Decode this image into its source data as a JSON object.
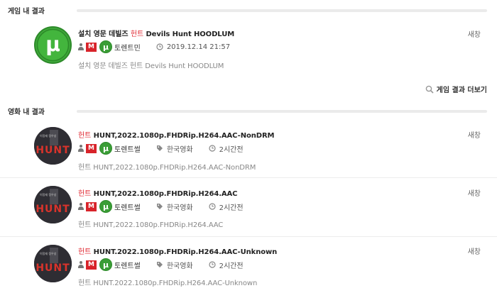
{
  "game_section": {
    "title": "게임 내 결과",
    "more_label": "게임 결과 더보기",
    "items": [
      {
        "title_prefix": "설치 영문 데빌즈",
        "title_highlight": "헌트",
        "title_suffix": "Devils Hunt HOODLUM",
        "nickname": "토렌트민",
        "date": "2019.12.14 21:57",
        "description": "설치 영문 데빌즈 헌트 Devils Hunt HOODLUM",
        "new_window": "새창"
      }
    ]
  },
  "movie_section": {
    "title": "영화 내 결과",
    "items": [
      {
        "title_highlight": "헌트",
        "title_suffix": "HUNT,2022.1080p.FHDRip.H264.AAC-NonDRM",
        "nickname": "토렌트썰",
        "category": "한국영화",
        "time": "2시간전",
        "description": "헌트 HUNT,2022.1080p.FHDRip.H264.AAC-NonDRM",
        "new_window": "새창",
        "poster_text": "HUNT"
      },
      {
        "title_highlight": "헌트",
        "title_suffix": "HUNT,2022.1080p.FHDRip.H264.AAC",
        "nickname": "토렌트썰",
        "category": "한국영화",
        "time": "2시간전",
        "description": "헌트 HUNT,2022.1080p.FHDRip.H264.AAC",
        "new_window": "새창",
        "poster_text": "HUNT"
      },
      {
        "title_highlight": "헌트",
        "title_suffix": "HUNT.2022.1080p.FHDRip.H264.AAC-Unknown",
        "nickname": "토렌트썰",
        "category": "한국영화",
        "time": "2시간전",
        "description": "헌트 HUNT.2022.1080p.FHDRip.H264.AAC-Unknown",
        "new_window": "새창",
        "poster_text": "HUNT"
      }
    ]
  },
  "badges": {
    "member_badge": "M",
    "level_icon": "μ"
  },
  "colors": {
    "highlight": "#e0262f",
    "badge_red": "#d8232a",
    "torrent_green": "#3fa83a"
  }
}
